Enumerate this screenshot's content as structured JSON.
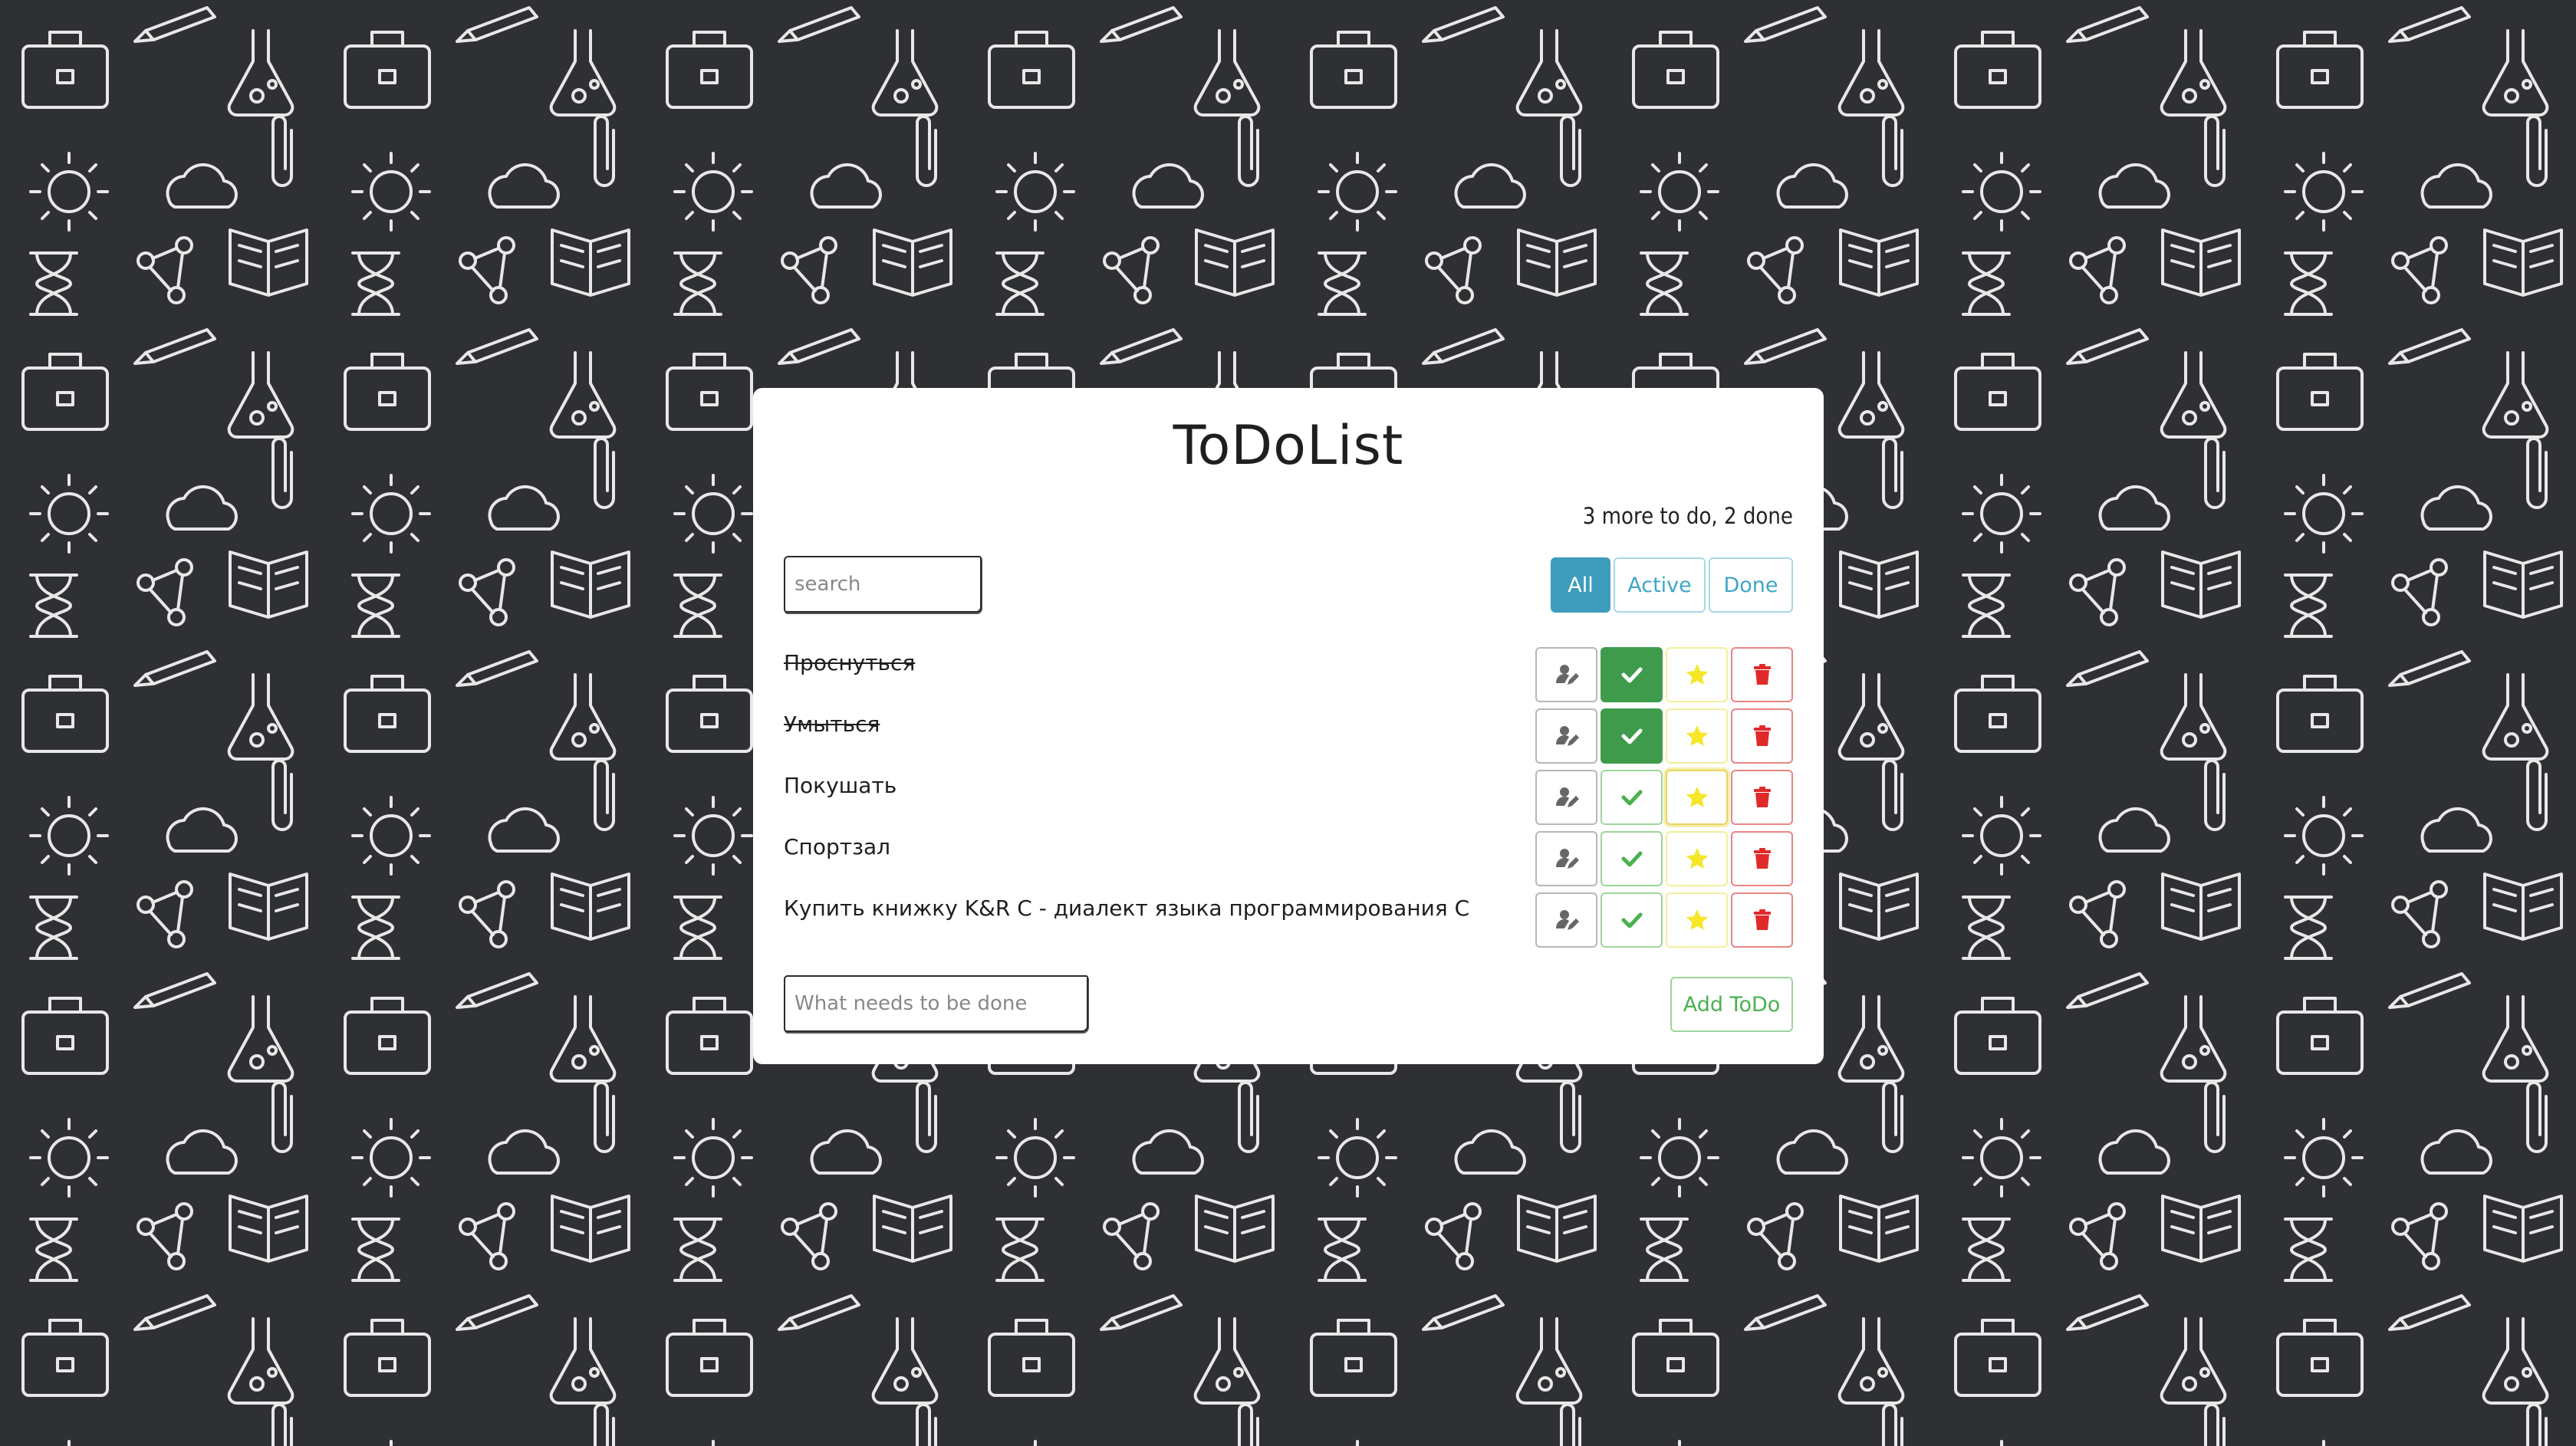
{
  "app": {
    "title": "ToDoList",
    "counter_text": "3 more to do, 2 done"
  },
  "search": {
    "placeholder": "search",
    "value": ""
  },
  "filters": [
    {
      "label": "All",
      "active": true
    },
    {
      "label": "Active",
      "active": false
    },
    {
      "label": "Done",
      "active": false
    }
  ],
  "todos": [
    {
      "text": "Проснуться",
      "done": true,
      "important": false
    },
    {
      "text": "Умыться",
      "done": true,
      "important": false
    },
    {
      "text": "Покушать",
      "done": false,
      "important": true
    },
    {
      "text": "Спортзал",
      "done": false,
      "important": false
    },
    {
      "text": "Купить книжку K&R C - диалект языка программирования C",
      "done": false,
      "important": false
    }
  ],
  "new_todo": {
    "placeholder": "What needs to be done",
    "value": ""
  },
  "add_button": {
    "label": "Add ToDo"
  },
  "icons": {
    "edit": "user-edit-icon",
    "done": "check-icon",
    "important": "star-icon",
    "delete": "trash-icon"
  },
  "colors": {
    "background": "#2f3033",
    "filter_active": "#3e9cbc",
    "done_green": "#3e9b4c",
    "star_yellow": "#f5e62a",
    "delete_red": "#e02a2a"
  }
}
